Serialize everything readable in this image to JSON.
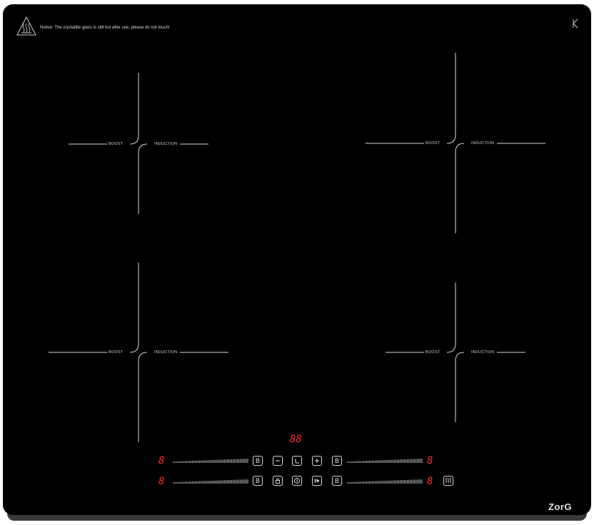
{
  "notice": {
    "text": "Notice: The crystallite glass is still hot after use, please do not touch!"
  },
  "zones": [
    {
      "id": "front-left",
      "boost": "BOOST",
      "induction": "INDUCTION"
    },
    {
      "id": "rear-right",
      "boost": "BOOST",
      "induction": "INDUCTION"
    },
    {
      "id": "rear-left",
      "boost": "BOOST",
      "induction": "INDUCTION"
    },
    {
      "id": "front-right",
      "boost": "BOOST",
      "induction": "INDUCTION"
    }
  ],
  "displays": {
    "timer": "88",
    "zone_left_top": "8",
    "zone_left_bottom": "8",
    "zone_right_top": "8",
    "zone_right_bottom": "8"
  },
  "buttons": {
    "boost_left_top": "B",
    "boost_left_bottom": "B",
    "boost_right_top": "B",
    "boost_right_bottom": "B"
  },
  "icons": [
    "warning-hot-surface-icon",
    "corner-mark-icon",
    "minus-icon",
    "timer-icon",
    "plus-icon",
    "lock-icon",
    "power-icon",
    "pause-icon",
    "bridge-icon"
  ],
  "brand": {
    "logo": "ZorG"
  },
  "colors": {
    "glass": "#000000",
    "display": "#ff2a2a",
    "print": "#d8d8d8"
  }
}
